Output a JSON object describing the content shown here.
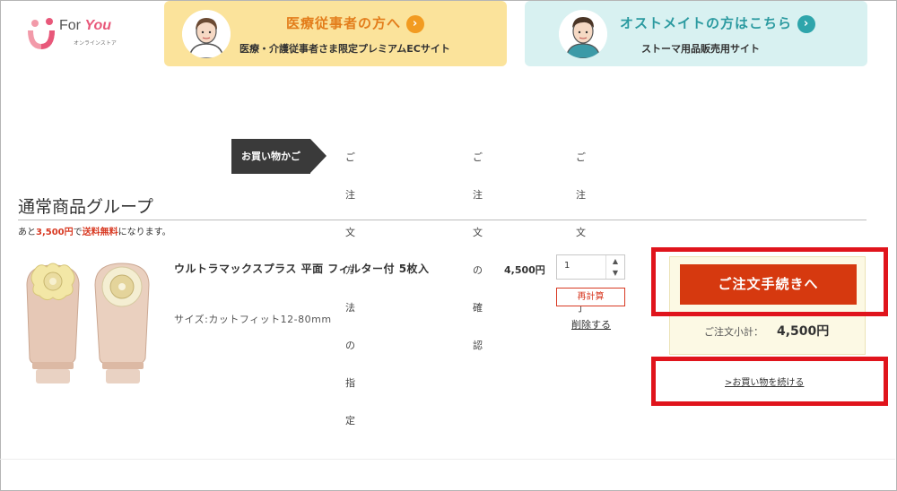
{
  "header": {
    "logo": {
      "brand": "For You",
      "subtitle": "オンラインストア"
    },
    "banner_medical": {
      "title": "医療従事者の方へ",
      "subtitle": "医療・介護従事者さま限定プレミアムECサイト"
    },
    "banner_ostomate": {
      "title": "オストメイトの方はこちら",
      "subtitle": "ストーマ用品販売用サイト"
    }
  },
  "steps": [
    {
      "label": "お買い物かご",
      "active": true
    },
    {
      "label": "ご注文方法の指定",
      "active": false
    },
    {
      "label": "ご注文の確認",
      "active": false
    },
    {
      "label": "ご注文完了",
      "active": false
    }
  ],
  "group": {
    "title": "通常商品グループ",
    "shipping_prefix": "あと",
    "shipping_amount": "3,500円",
    "shipping_middle": "で",
    "shipping_free": "送料無料",
    "shipping_suffix": "になります。"
  },
  "product": {
    "name": "ウルトラマックスプラス 平面 フィルター付 5枚入",
    "size": "サイズ:カットフィット12-80mm",
    "price": "4,500円",
    "quantity": "1",
    "recalc_label": "再計算",
    "delete_label": "削除する"
  },
  "summary": {
    "checkout_label": "ご注文手続きへ",
    "subtotal_label": "ご注文小計：",
    "subtotal_value": "4,500円",
    "continue_label": ">お買い物を続ける"
  },
  "colors": {
    "accent_red": "#d6390f",
    "highlight_red": "#e0141c",
    "banner_yellow": "#fbe39b",
    "banner_teal": "#d8f1f1"
  }
}
